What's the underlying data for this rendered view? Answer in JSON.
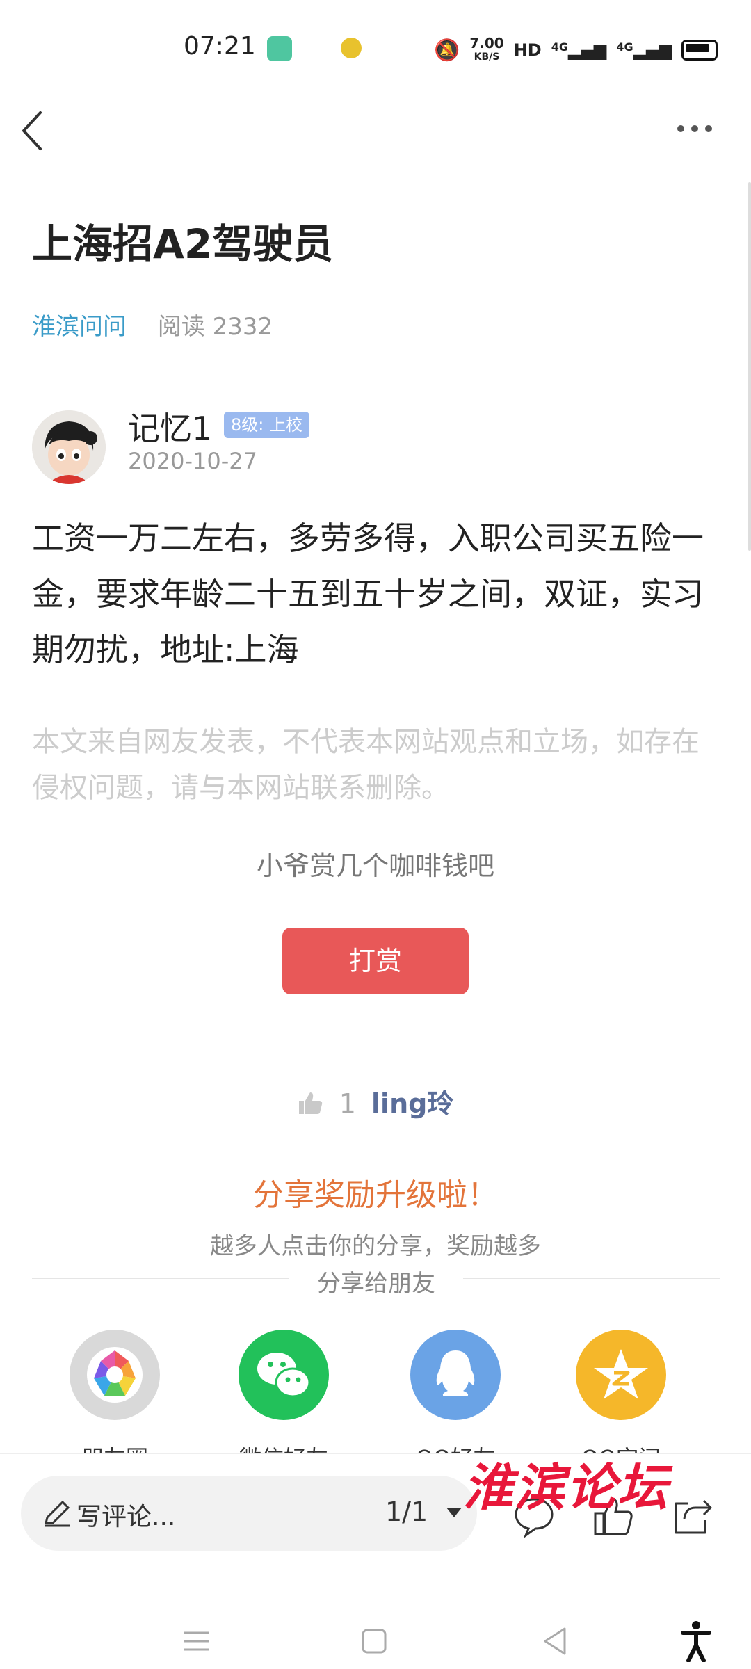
{
  "status": {
    "time": "07:21",
    "network_speed": "7.00",
    "speed_unit": "KB/S",
    "hd": "HD",
    "sig1": "4G",
    "sig2": "4G"
  },
  "post": {
    "title": "上海招A2驾驶员",
    "category": "淮滨问问",
    "read_label": "阅读",
    "read_count": "2332",
    "author": "记忆1",
    "badge": "8级: 上校",
    "date": "2020-10-27",
    "body": "工资一万二左右，多劳多得，入职公司买五险一金，要求年龄二十五到五十岁之间，双证，实习期勿扰，地址:上海",
    "disclaimer": "本文来自网友发表，不代表本网站观点和立场，如存在侵权问题，请与本网站联系删除。"
  },
  "tip": {
    "text": "小爷赏几个咖啡钱吧",
    "button": "打赏"
  },
  "likes": {
    "count": "1",
    "user": "ling玲"
  },
  "share": {
    "title": "分享奖励升级啦！",
    "subtitle": "越多人点击你的分享，奖励越多",
    "divider_label": "分享给朋友",
    "targets": [
      {
        "label": "朋友圈",
        "icon": "moments-icon",
        "color": "#d9d9d9"
      },
      {
        "label": "微信好友",
        "icon": "wechat-icon",
        "color": "#22c15a"
      },
      {
        "label": "QQ好友",
        "icon": "qq-icon",
        "color": "#6aa3e6"
      },
      {
        "label": "QQ空间",
        "icon": "qzone-icon",
        "color": "#f5b72a"
      }
    ]
  },
  "bottom": {
    "comment_placeholder": "写评论...",
    "page": "1/1",
    "watermark": "淮滨论坛"
  }
}
